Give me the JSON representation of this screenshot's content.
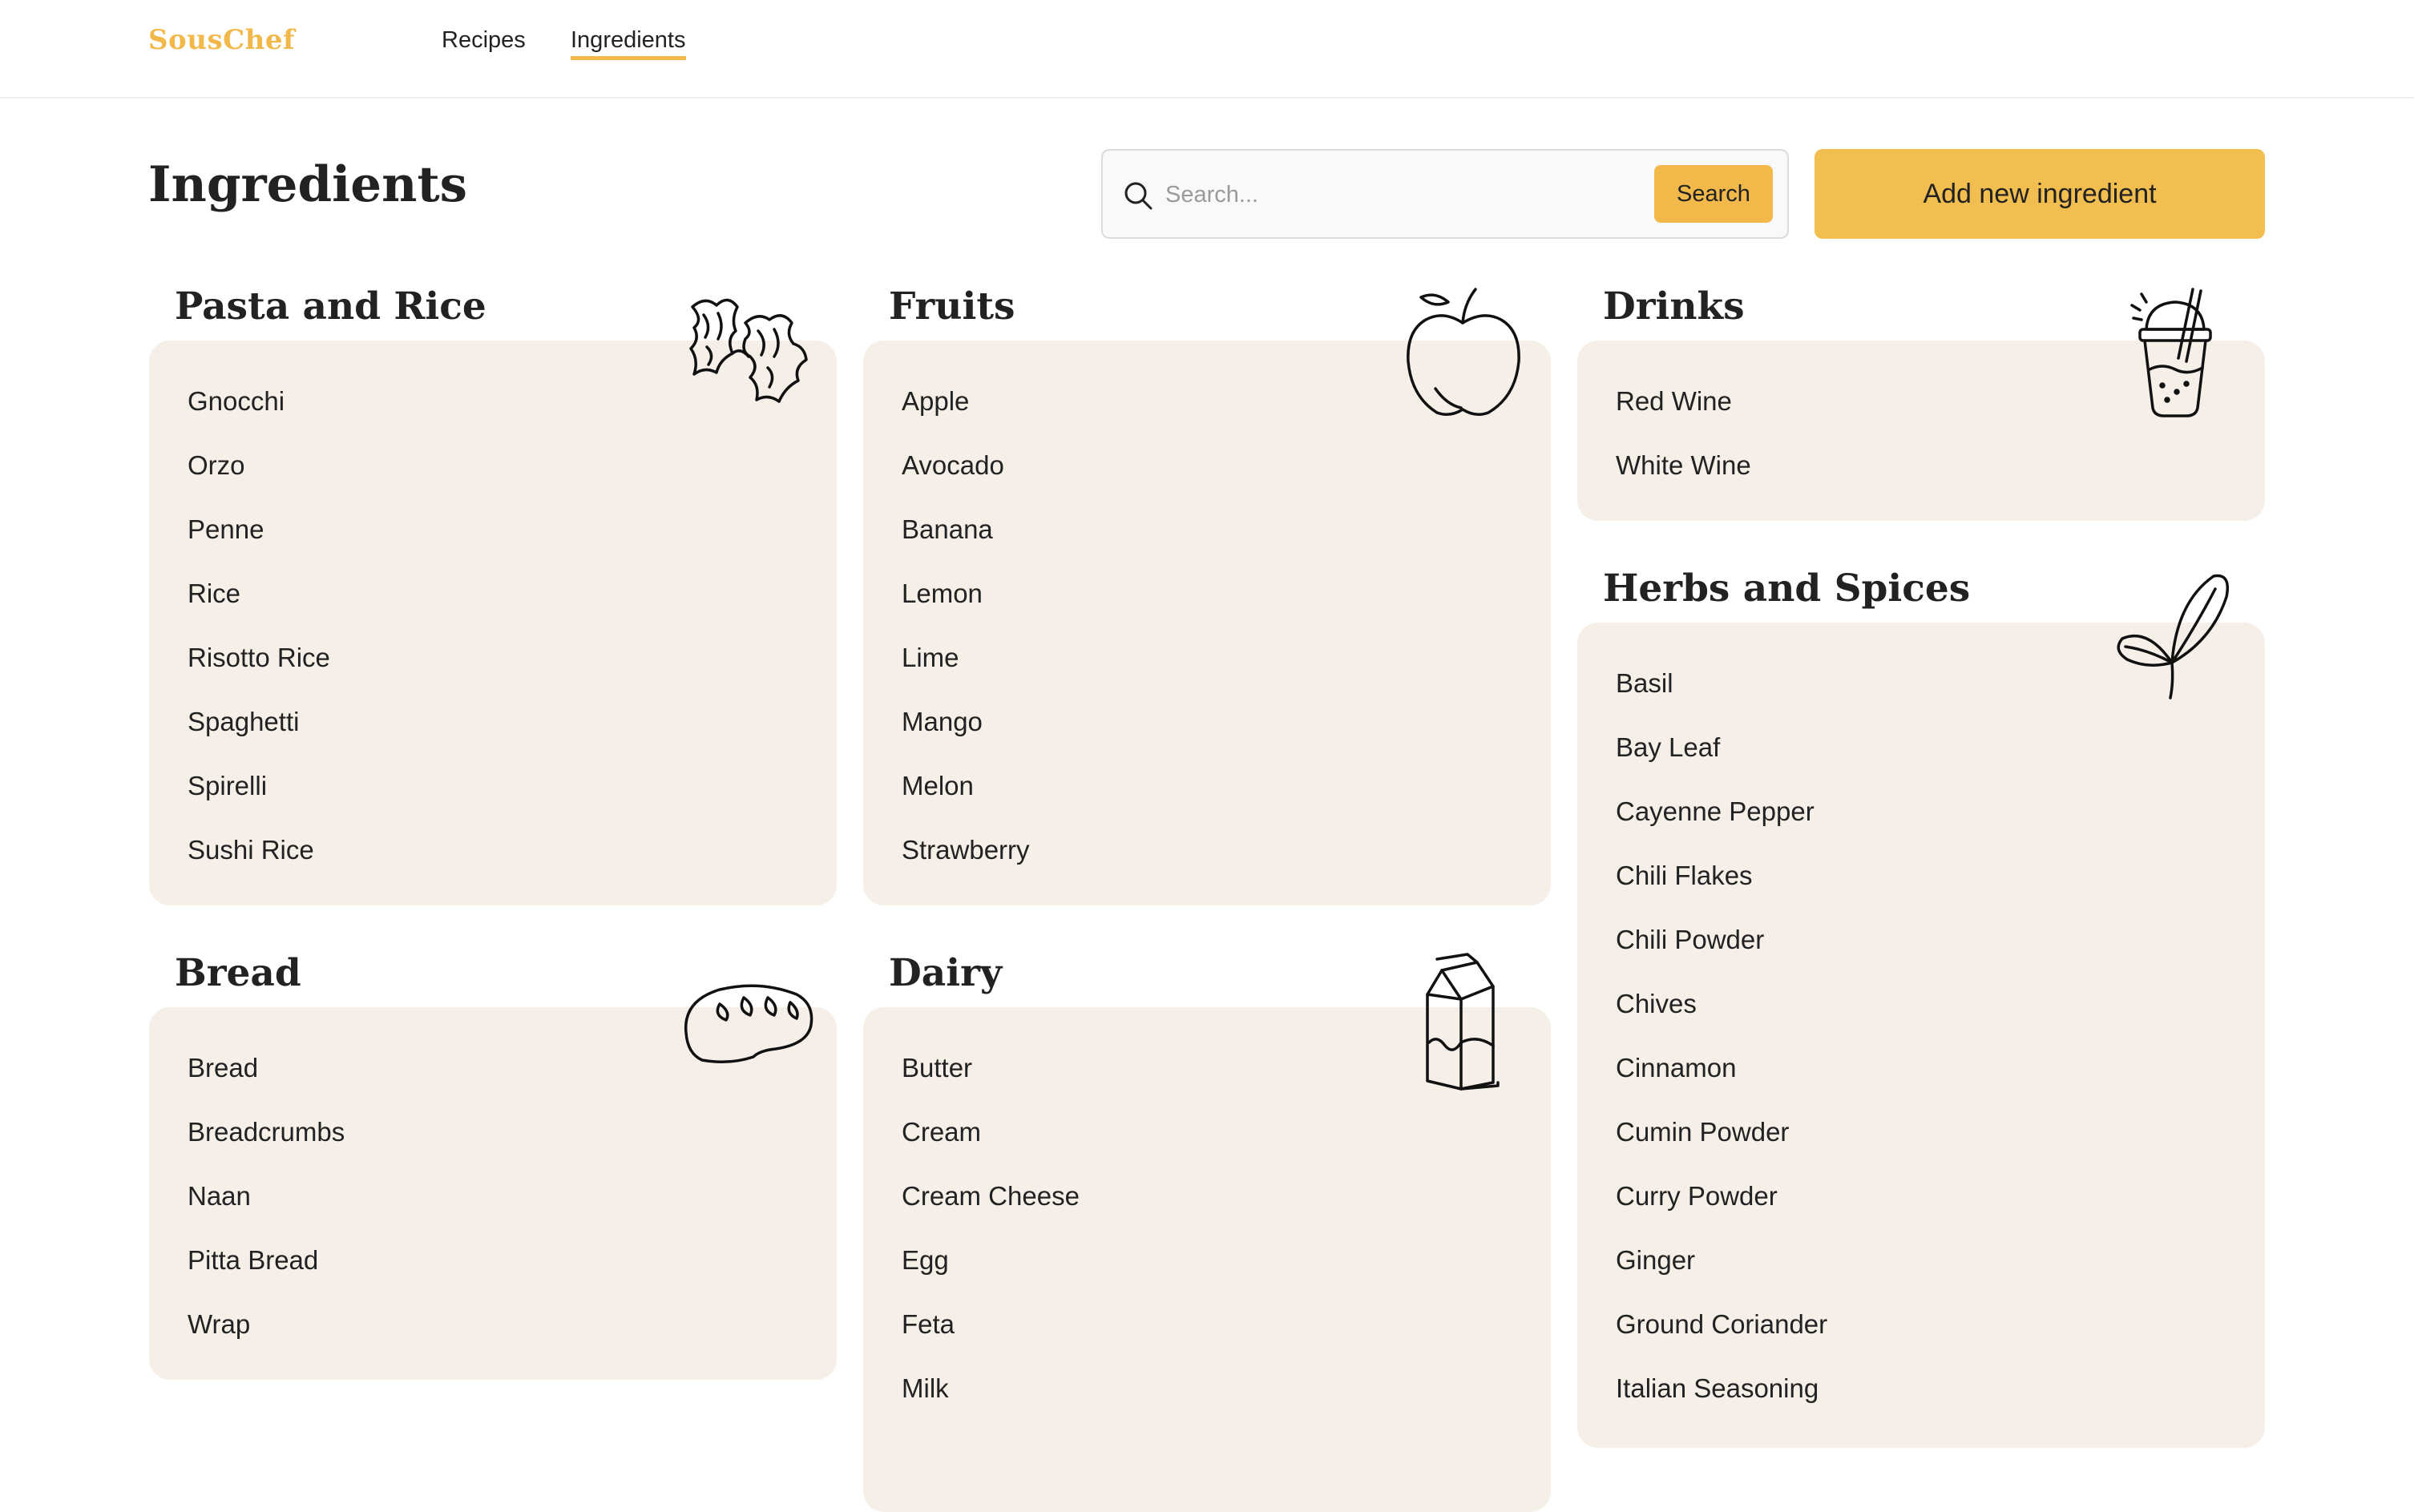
{
  "header": {
    "brand": "SousChef",
    "nav": [
      {
        "label": "Recipes",
        "active": false
      },
      {
        "label": "Ingredients",
        "active": true
      }
    ]
  },
  "page": {
    "title": "Ingredients",
    "search": {
      "placeholder": "Search...",
      "value": "",
      "button_label": "Search"
    },
    "add_button_label": "Add new ingredient"
  },
  "categories": [
    {
      "title": "Pasta and Rice",
      "icon": "pasta-icon",
      "items": [
        "Gnocchi",
        "Orzo",
        "Penne",
        "Rice",
        "Risotto Rice",
        "Spaghetti",
        "Spirelli",
        "Sushi Rice"
      ]
    },
    {
      "title": "Fruits",
      "icon": "apple-icon",
      "items": [
        "Apple",
        "Avocado",
        "Banana",
        "Lemon",
        "Lime",
        "Mango",
        "Melon",
        "Strawberry"
      ]
    },
    {
      "title": "Drinks",
      "icon": "drink-cup-icon",
      "items": [
        "Red Wine",
        "White Wine"
      ]
    },
    {
      "title": "Bread",
      "icon": "bread-icon",
      "items": [
        "Bread",
        "Breadcrumbs",
        "Naan",
        "Pitta Bread",
        "Wrap"
      ]
    },
    {
      "title": "Dairy",
      "icon": "milk-carton-icon",
      "items": [
        "Butter",
        "Cream",
        "Cream Cheese",
        "Egg",
        "Feta",
        "Milk"
      ]
    },
    {
      "title": "Herbs and Spices",
      "icon": "leaf-icon",
      "items": [
        "Basil",
        "Bay Leaf",
        "Cayenne Pepper",
        "Chili Flakes",
        "Chili Powder",
        "Chives",
        "Cinnamon",
        "Cumin Powder",
        "Curry Powder",
        "Ginger",
        "Ground Coriander",
        "Italian Seasoning"
      ]
    }
  ],
  "colors": {
    "accent": "#f2b94a",
    "card_background": "#f5efe8",
    "text": "#222222"
  }
}
